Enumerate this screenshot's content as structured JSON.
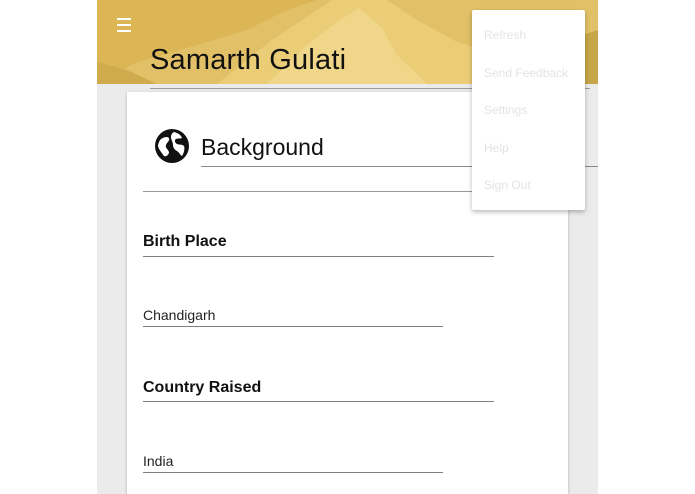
{
  "header": {
    "menu_icon": "hamburger-menu-icon",
    "title": "Samarth Gulati",
    "background_color": "#d9b24f"
  },
  "section": {
    "icon": "globe-icon",
    "title": "Background"
  },
  "fields": [
    {
      "label": "Birth Place",
      "value": "Chandigarh"
    },
    {
      "label": "Country Raised",
      "value": "India"
    }
  ],
  "overflow_menu": {
    "items": [
      {
        "label": "Refresh"
      },
      {
        "label": "Send Feedback"
      },
      {
        "label": "Settings"
      },
      {
        "label": "Help"
      },
      {
        "label": "Sign Out"
      }
    ]
  }
}
